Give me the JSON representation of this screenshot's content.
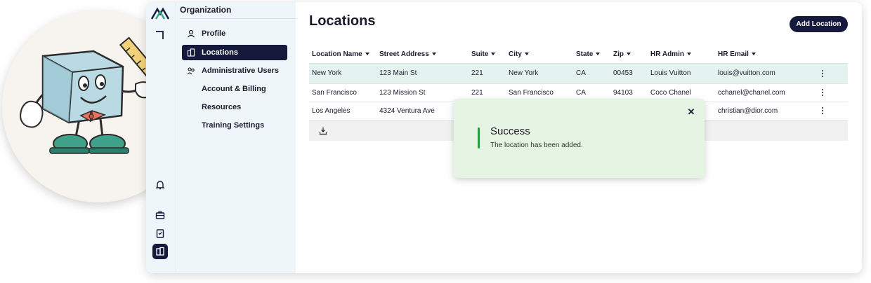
{
  "organization": {
    "title": "Organization"
  },
  "subnav": {
    "items": [
      {
        "label": "Profile",
        "icon": "user-icon",
        "active": false
      },
      {
        "label": "Locations",
        "icon": "building-icon",
        "active": true
      },
      {
        "label": "Administrative Users",
        "icon": "users-icon",
        "active": false
      },
      {
        "label": "Account & Billing",
        "icon": "card-icon",
        "active": false
      },
      {
        "label": "Resources",
        "icon": "book-icon",
        "active": false
      },
      {
        "label": "Training Settings",
        "icon": "settings-icon",
        "active": false
      }
    ]
  },
  "page": {
    "title": "Locations",
    "add_button": "Add Location"
  },
  "table": {
    "columns": [
      "Location Name",
      "Street Address",
      "Suite",
      "City",
      "State",
      "Zip",
      "HR Admin",
      "HR Email"
    ],
    "rows": [
      [
        "New York",
        "123 Main St",
        "221",
        "New York",
        "CA",
        "00453",
        "Louis Vuitton",
        "louis@vuitton.com"
      ],
      [
        "San Francisco",
        "123 Mission St",
        "221",
        "San Francisco",
        "CA",
        "94103",
        "Coco Chanel",
        "cchanel@chanel.com"
      ],
      [
        "Los Angeles",
        "4324 Ventura Ave",
        "",
        "",
        "",
        "",
        "",
        "christian@dior.com"
      ]
    ],
    "selected_row": 0
  },
  "toast": {
    "title": "Success",
    "message": "The location has been added."
  },
  "colors": {
    "primary": "#151a3d",
    "selected_row": "#e4f3ef",
    "toast_bg": "#e6f5e3",
    "toast_accent": "#2e9b3b",
    "sidebar_bg": "#eef6f9"
  }
}
